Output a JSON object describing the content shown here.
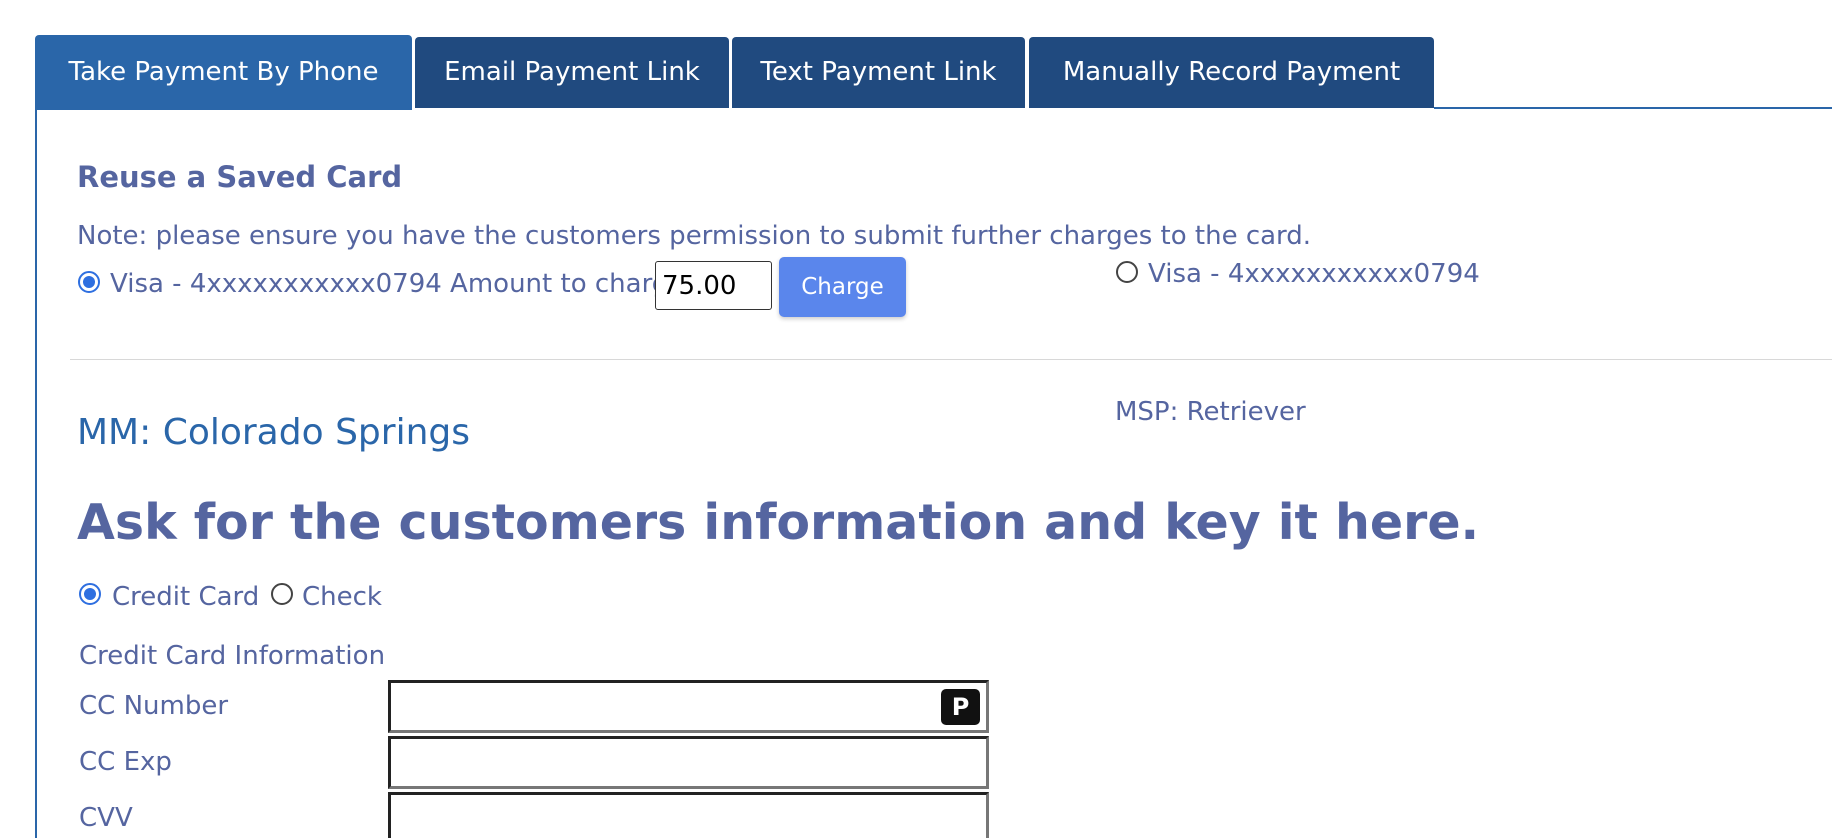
{
  "tabs": [
    {
      "label": "Take Payment By Phone",
      "active": true
    },
    {
      "label": "Email Payment Link",
      "active": false
    },
    {
      "label": "Text Payment Link",
      "active": false
    },
    {
      "label": "Manually Record Payment",
      "active": false
    }
  ],
  "saved_card": {
    "title": "Reuse a Saved Card",
    "note": "Note: please ensure you have the customers permission to submit further charges to the card.",
    "card1_label": "Visa - 4xxxxxxxxxxx0794 Amount to charge",
    "amount": "75.00",
    "charge_button": "Charge",
    "card2_label": "Visa - 4xxxxxxxxxxx0794"
  },
  "location": "MM: Colorado Springs",
  "msp": "MSP: Retriever",
  "heading": "Ask for the customers information and key it here.",
  "payment_method": {
    "credit_card_label": "Credit Card",
    "check_label": "Check",
    "selected": "Credit Card"
  },
  "cc_form": {
    "section_label": "Credit Card Information",
    "cc_number_label": "CC Number",
    "cc_exp_label": "CC Exp",
    "cvv_label": "CVV",
    "badge": "P"
  },
  "colors": {
    "tab_active": "#2a66a9",
    "tab_inactive": "#204a7f",
    "text_muted": "#5565a0",
    "charge_button": "#5a86ec",
    "radio_checked": "#2e6fe0"
  }
}
